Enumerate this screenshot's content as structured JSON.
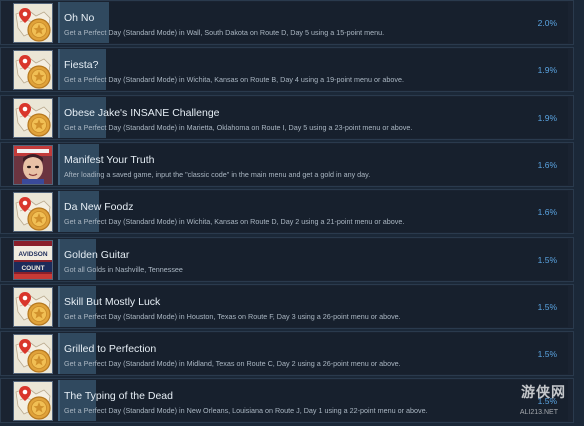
{
  "achievements": [
    {
      "title": "Oh No",
      "description": "Get a Perfect Day (Standard Mode) in Wall, South Dakota on Route D, Day 5 using a 15-point menu.",
      "percent": "2.0%",
      "percent_value": 2.0,
      "icon": "map-medal-icon"
    },
    {
      "title": "Fiesta?",
      "description": "Get a Perfect Day (Standard Mode) in Wichita, Kansas on Route B, Day 4 using a 19-point menu or above.",
      "percent": "1.9%",
      "percent_value": 1.9,
      "icon": "map-medal-icon"
    },
    {
      "title": "Obese Jake's INSANE Challenge",
      "description": "Get a Perfect Day (Standard Mode) in Marietta, Oklahoma on Route I, Day 5 using a 23-point menu or above.",
      "percent": "1.9%",
      "percent_value": 1.9,
      "icon": "map-medal-icon"
    },
    {
      "title": "Manifest Your Truth",
      "description": "After loading a saved game, input the \"classic code\" in the main menu and get a gold in any day.",
      "percent": "1.6%",
      "percent_value": 1.6,
      "icon": "character-portrait-icon"
    },
    {
      "title": "Da New Foodz",
      "description": "Get a Perfect Day (Standard Mode) in Wichita, Kansas on Route D, Day 2 using a 21-point menu or above.",
      "percent": "1.6%",
      "percent_value": 1.6,
      "icon": "map-medal-icon"
    },
    {
      "title": "Golden Guitar",
      "description": "Got all Golds in Nashville, Tennessee",
      "percent": "1.5%",
      "percent_value": 1.5,
      "icon": "sign-icon"
    },
    {
      "title": "Skill But Mostly Luck",
      "description": "Get a Perfect Day (Standard Mode) in Houston, Texas on Route F, Day 3 using a 26-point menu or above.",
      "percent": "1.5%",
      "percent_value": 1.5,
      "icon": "map-medal-icon"
    },
    {
      "title": "Grilled to Perfection",
      "description": "Get a Perfect Day (Standard Mode) in Midland, Texas on Route C, Day 2 using a 26-point menu or above.",
      "percent": "1.5%",
      "percent_value": 1.5,
      "icon": "map-medal-icon"
    },
    {
      "title": "The Typing of the Dead",
      "description": "Get a Perfect Day (Standard Mode) in New Orleans, Louisiana on Route J, Day 1 using a 22-point menu or above.",
      "percent": "1.5%",
      "percent_value": 1.5,
      "icon": "map-medal-icon"
    }
  ],
  "sign_icon_text": "AVIDSON COUNT",
  "watermark": {
    "text": "游侠网",
    "sub": "ALI213.NET"
  },
  "colors": {
    "background": "#1b2838",
    "row": "#1a2331",
    "percent": "#5aa3e0",
    "bar_fill": "#30495f"
  }
}
